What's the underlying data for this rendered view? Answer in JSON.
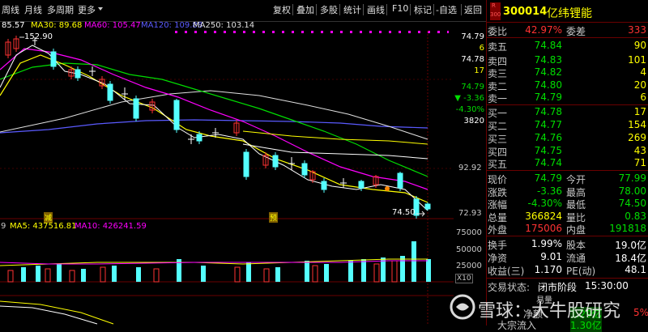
{
  "toolbar": {
    "left": [
      "周线",
      "月线",
      "多周期",
      "更多"
    ],
    "right": [
      "复权",
      "叠加",
      "多股",
      "统计",
      "画线",
      "F10",
      "标记",
      "-自选",
      "返回"
    ]
  },
  "ma_legend": {
    "ma5": "85.57",
    "ma30": "MA30: 89.68",
    "ma60": "MA60: 105.47",
    "ma120": "MA120: 109.88",
    "ma250": "MA250: 103.14"
  },
  "vol_legend": {
    "prefix": "9",
    "ma5": "MA5: 437516.81",
    "ma10": "MA10: 426241.59"
  },
  "kline_labels": {
    "high": "152.90",
    "low": "74.50",
    "marker_reduce": "减",
    "marker_preview": "预"
  },
  "price_axis": [
    "92.92",
    "72.93"
  ],
  "volume_axis": [
    "75000",
    "50000",
    "25000",
    "X10"
  ],
  "mini_quote": {
    "price1": "74.79",
    "v1": "6",
    "price2": "74.78",
    "v2": "17",
    "price3": "74.79",
    "change": "▼ -3.36",
    "pct": "-4.30%",
    "vol": "3820"
  },
  "stock": {
    "code": "300014",
    "name": "亿纬锂能",
    "badge_r": "R",
    "badge_num": "300"
  },
  "order": {
    "weibi_label": "委比",
    "weibi": "42.97%",
    "weicha_label": "委差",
    "weicha": "333"
  },
  "asks": [
    {
      "label": "卖五",
      "price": "74.84",
      "vol": "90"
    },
    {
      "label": "卖四",
      "price": "74.83",
      "vol": "101"
    },
    {
      "label": "卖三",
      "price": "74.82",
      "vol": "4"
    },
    {
      "label": "卖二",
      "price": "74.80",
      "vol": "20"
    },
    {
      "label": "卖一",
      "price": "74.79",
      "vol": "6"
    }
  ],
  "bids": [
    {
      "label": "买一",
      "price": "74.78",
      "vol": "17"
    },
    {
      "label": "买二",
      "price": "74.77",
      "vol": "154"
    },
    {
      "label": "买三",
      "price": "74.76",
      "vol": "269"
    },
    {
      "label": "买四",
      "price": "74.75",
      "vol": "43"
    },
    {
      "label": "买五",
      "price": "74.74",
      "vol": "71"
    }
  ],
  "stats": [
    {
      "l1": "现价",
      "v1": "74.79",
      "c1": "#00dd00",
      "l2": "今开",
      "v2": "77.99",
      "c2": "#00dd00"
    },
    {
      "l1": "涨跌",
      "v1": "-3.36",
      "c1": "#00dd00",
      "l2": "最高",
      "v2": "78.00",
      "c2": "#00dd00"
    },
    {
      "l1": "涨幅",
      "v1": "-4.30%",
      "c1": "#00dd00",
      "l2": "最低",
      "v2": "74.50",
      "c2": "#00dd00"
    },
    {
      "l1": "总量",
      "v1": "366824",
      "c1": "#ffff00",
      "l2": "量比",
      "v2": "0.83",
      "c2": "#00dd00"
    },
    {
      "l1": "外盘",
      "v1": "175006",
      "c1": "#ff3333",
      "l2": "内盘",
      "v2": "191818",
      "c2": "#00dd00"
    }
  ],
  "stats2": [
    {
      "l1": "换手",
      "v1": "1.99%",
      "l2": "股本",
      "v2": "19.0亿"
    },
    {
      "l1": "净资",
      "v1": "9.01",
      "l2": "流通",
      "v2": "18.4亿"
    },
    {
      "l1": "收益(三)",
      "v1": "1.170",
      "l2": "PE(动)",
      "v2": "48.1"
    }
  ],
  "status": {
    "label": "交易状态:",
    "value": "闭市阶段",
    "time": "15:30:00",
    "row2": "易量",
    "row3a": "净额",
    "row3b": "1.29亿",
    "row3c": "5%",
    "row4a": "大宗流入",
    "row4b": "1.30亿"
  },
  "watermark": "雪球：大牛股研究",
  "colors": {
    "red": "#ff3232",
    "green": "#00dd00",
    "cyan": "#54ffff",
    "yellow": "#ffff00"
  }
}
